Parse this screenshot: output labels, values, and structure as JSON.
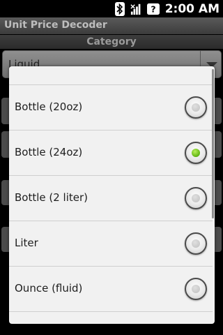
{
  "status_bar": {
    "time": "2:00 AM",
    "icons": [
      "bluetooth-icon",
      "signal-icon",
      "unknown-status-icon"
    ],
    "unknown_glyph": "?"
  },
  "app": {
    "title": "Unit Price Decoder"
  },
  "category": {
    "label": "Category",
    "selected_value": "Liquid"
  },
  "dialog": {
    "options": [
      {
        "label": "",
        "checked": false
      },
      {
        "label": "Bottle (20oz)",
        "checked": false
      },
      {
        "label": "Bottle (24oz)",
        "checked": true
      },
      {
        "label": "Bottle (2 liter)",
        "checked": false
      },
      {
        "label": "Liter",
        "checked": false
      },
      {
        "label": "Ounce (fluid)",
        "checked": false
      }
    ]
  },
  "colors": {
    "radio_checked": "#5fb312",
    "dialog_bg": "#f1f1f1"
  }
}
